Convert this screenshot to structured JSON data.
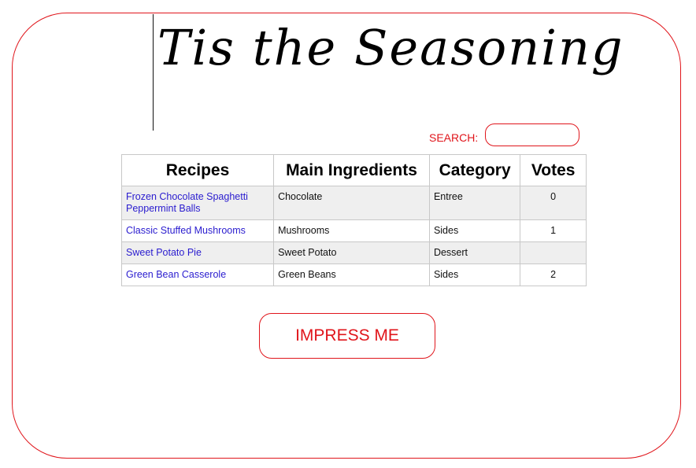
{
  "site": {
    "title": "Tis the Seasoning"
  },
  "search": {
    "label": "SEARCH:",
    "value": "",
    "placeholder": ""
  },
  "table": {
    "headers": [
      "Recipes",
      "Main Ingredients",
      "Category",
      "Votes"
    ],
    "rows": [
      {
        "recipe": "Frozen Chocolate Spaghetti Peppermint Balls",
        "ingredient": "Chocolate",
        "category": "Entree",
        "votes": "0"
      },
      {
        "recipe": "Classic Stuffed Mushrooms",
        "ingredient": "Mushrooms",
        "category": "Sides",
        "votes": "1"
      },
      {
        "recipe": "Sweet Potato Pie",
        "ingredient": "Sweet Potato",
        "category": "Dessert",
        "votes": ""
      },
      {
        "recipe": "Green Bean Casserole",
        "ingredient": "Green Beans",
        "category": "Sides",
        "votes": "2"
      }
    ]
  },
  "actions": {
    "impress_label": "IMPRESS ME"
  },
  "colors": {
    "accent": "#e0151b",
    "link": "#2a1ccf",
    "row_alt": "#efefef"
  }
}
